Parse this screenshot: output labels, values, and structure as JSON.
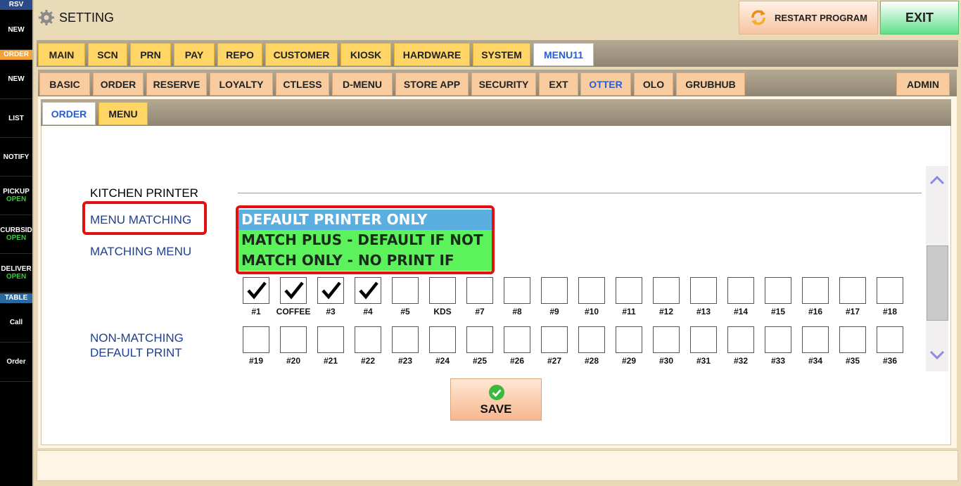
{
  "sidebar": {
    "rsv_header": "RSV",
    "order_header": "ORDER",
    "table_header": "TABLE",
    "items": [
      {
        "label": "NEW",
        "status": ""
      },
      {
        "label": "NEW",
        "status": ""
      },
      {
        "label": "LIST",
        "status": ""
      },
      {
        "label": "NOTIFY",
        "status": ""
      },
      {
        "label": "PICKUP",
        "status": "OPEN"
      },
      {
        "label": "CURBSID",
        "status": "OPEN"
      },
      {
        "label": "DELIVER",
        "status": "OPEN"
      },
      {
        "label": "Call",
        "status": ""
      },
      {
        "label": "Order",
        "status": ""
      }
    ]
  },
  "titlebar": {
    "title": "SETTING",
    "restart_label": "RESTART PROGRAM",
    "exit_label": "EXIT"
  },
  "tabs_main": [
    "MAIN",
    "SCN",
    "PRN",
    "PAY",
    "REPO",
    "CUSTOMER",
    "KIOSK",
    "HARDWARE",
    "SYSTEM",
    "MENU11"
  ],
  "tabs_menu11": [
    "BASIC",
    "ORDER",
    "RESERVE",
    "LOYALTY",
    "CTLESS",
    "D-MENU",
    "STORE APP",
    "SECURITY",
    "EXT",
    "OTTER",
    "OLO",
    "GRUBHUB",
    "ADMIN"
  ],
  "tabs_otter": [
    "ORDER",
    "MENU"
  ],
  "active": {
    "main": "MENU11",
    "sub": "OTTER",
    "otter": "ORDER"
  },
  "content": {
    "kitchen_printer": "KITCHEN PRINTER",
    "menu_matching": "MENU MATCHING",
    "matching_menu": "MATCHING MENU",
    "non_matching_line1": "NON-MATCHING",
    "non_matching_line2": "DEFAULT PRINT",
    "options": [
      "DEFAULT PRINTER ONLY",
      "MATCH PLUS - DEFAULT IF NOT",
      "MATCH ONLY - NO PRINT IF NOT"
    ],
    "selected_option": "DEFAULT PRINTER ONLY",
    "matching_printers": [
      {
        "label": "#1",
        "checked": true
      },
      {
        "label": "COFFEE",
        "checked": true
      },
      {
        "label": "#3",
        "checked": true
      },
      {
        "label": "#4",
        "checked": true
      },
      {
        "label": "#5",
        "checked": false
      },
      {
        "label": "KDS",
        "checked": false
      },
      {
        "label": "#7",
        "checked": false
      },
      {
        "label": "#8",
        "checked": false
      },
      {
        "label": "#9",
        "checked": false
      },
      {
        "label": "#10",
        "checked": false
      },
      {
        "label": "#11",
        "checked": false
      },
      {
        "label": "#12",
        "checked": false
      },
      {
        "label": "#13",
        "checked": false
      },
      {
        "label": "#14",
        "checked": false
      },
      {
        "label": "#15",
        "checked": false
      },
      {
        "label": "#16",
        "checked": false
      },
      {
        "label": "#17",
        "checked": false
      },
      {
        "label": "#18",
        "checked": false
      }
    ],
    "default_printers": [
      {
        "label": "#19",
        "checked": false
      },
      {
        "label": "#20",
        "checked": false
      },
      {
        "label": "#21",
        "checked": false
      },
      {
        "label": "#22",
        "checked": false
      },
      {
        "label": "#23",
        "checked": false
      },
      {
        "label": "#24",
        "checked": false
      },
      {
        "label": "#25",
        "checked": false
      },
      {
        "label": "#26",
        "checked": false
      },
      {
        "label": "#27",
        "checked": false
      },
      {
        "label": "#28",
        "checked": false
      },
      {
        "label": "#29",
        "checked": false
      },
      {
        "label": "#30",
        "checked": false
      },
      {
        "label": "#31",
        "checked": false
      },
      {
        "label": "#32",
        "checked": false
      },
      {
        "label": "#33",
        "checked": false
      },
      {
        "label": "#34",
        "checked": false
      },
      {
        "label": "#35",
        "checked": false
      },
      {
        "label": "#36",
        "checked": false
      }
    ],
    "save_label": "SAVE"
  },
  "icons": {
    "gear": "gear-icon",
    "restart": "refresh-icon",
    "save": "check-circle-icon",
    "scroll_up": "chevron-up-icon",
    "scroll_down": "chevron-down-icon"
  },
  "colors": {
    "tab_main": "#ffd566",
    "tab_sub": "#f8cc9f",
    "active_tab_text": "#2a5bd0",
    "option_selected": "#5aafe0",
    "option": "#5cf25c",
    "highlight": "#e21010",
    "label_blue": "#1f3f8c",
    "exit_green": "#5fe08a"
  }
}
